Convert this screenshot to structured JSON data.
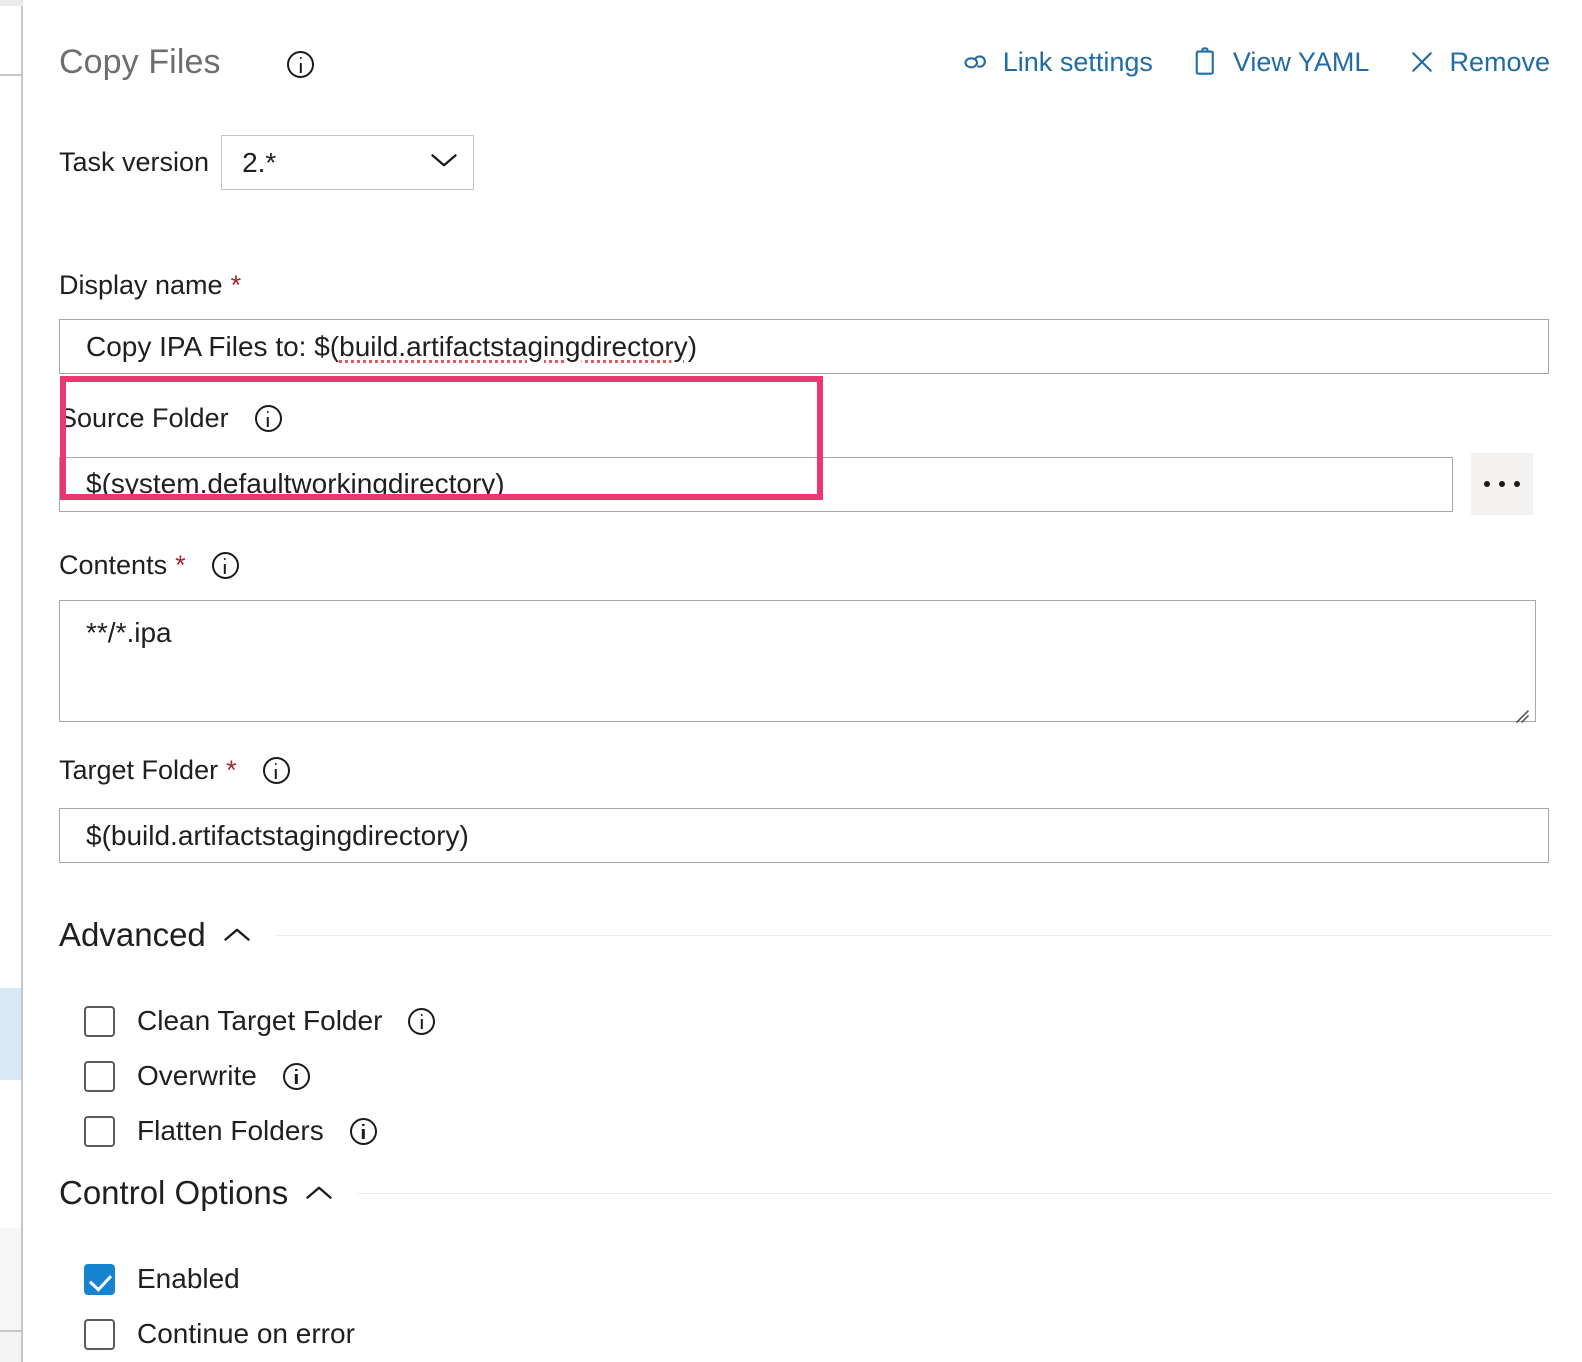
{
  "header": {
    "title": "Copy Files",
    "title_info_icon": "info-icon",
    "actions": [
      {
        "label": "Link settings",
        "icon": "link-icon"
      },
      {
        "label": "View YAML",
        "icon": "clipboard-icon"
      },
      {
        "label": "Remove",
        "icon": "close-x-icon"
      }
    ]
  },
  "task_version": {
    "label": "Task version",
    "value": "2.*",
    "chevron_icon": "chevron-down-icon"
  },
  "fields": {
    "display_name": {
      "label": "Display name",
      "required_marker": "*",
      "value_prefix": "Copy IPA Files to: $(",
      "value_spellerror": "build.artifactstagingdirectory",
      "value_suffix": ")",
      "full_value": "Copy IPA Files to: $(build.artifactstagingdirectory)",
      "highlighted": true
    },
    "source_folder": {
      "label": "Source Folder",
      "info_icon": "info-icon",
      "value": "$(system.defaultworkingdirectory)",
      "browse_label": "...",
      "browse_icon": "ellipsis-icon"
    },
    "contents": {
      "label": "Contents",
      "required_marker": "*",
      "info_icon": "info-icon",
      "value": "**/*.ipa",
      "resize_icon": "resize-grip-icon"
    },
    "target_folder": {
      "label": "Target Folder",
      "required_marker": "*",
      "info_icon": "info-icon",
      "value": "$(build.artifactstagingdirectory)"
    }
  },
  "sections": {
    "advanced": {
      "title": "Advanced",
      "collapse_icon": "chevron-up-icon",
      "checkboxes": [
        {
          "label": "Clean Target Folder",
          "checked": false,
          "info_icon": "info-icon"
        },
        {
          "label": "Overwrite",
          "checked": false,
          "info_icon": "info-icon"
        },
        {
          "label": "Flatten Folders",
          "checked": false,
          "info_icon": "info-icon"
        }
      ]
    },
    "control_options": {
      "title": "Control Options",
      "collapse_icon": "chevron-up-icon",
      "checkboxes": [
        {
          "label": "Enabled",
          "checked": true
        },
        {
          "label": "Continue on error",
          "checked": false
        }
      ]
    }
  },
  "colors": {
    "accent_link": "#216ca5",
    "highlight_box": "#e8386f",
    "required_star": "#a4262c",
    "checkbox_checked": "#1683d0",
    "title_gray": "#6e6e6e",
    "sidebar_selected": "#d7e8f6"
  }
}
